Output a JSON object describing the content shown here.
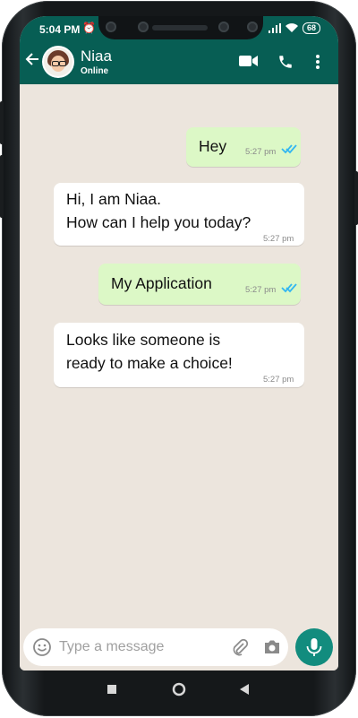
{
  "status_bar": {
    "time": "5:04 PM",
    "battery": "68"
  },
  "contact": {
    "name": "Niaa",
    "status": "Online"
  },
  "messages": [
    {
      "direction": "outgoing",
      "text": "Hey",
      "time": "5:27 pm",
      "read": true
    },
    {
      "direction": "incoming",
      "text": "Hi, I am Niaa.\nHow can I help you today?",
      "time": "5:27 pm"
    },
    {
      "direction": "outgoing",
      "text": "My Application",
      "time": "5:27 pm",
      "read": true
    },
    {
      "direction": "incoming",
      "text": "Looks like someone is\nready to make a choice!",
      "time": "5:27 pm"
    }
  ],
  "input": {
    "placeholder": "Type a message"
  },
  "icons": {
    "back": "arrow-left-icon",
    "video": "video-call-icon",
    "call": "phone-icon",
    "menu": "more-vert-icon",
    "emoji": "emoji-icon",
    "attach": "paperclip-icon",
    "camera": "camera-icon",
    "mic": "mic-icon",
    "read": "double-check-icon"
  },
  "colors": {
    "header": "#075e54",
    "outgoing_bubble": "#dcf8c6",
    "incoming_bubble": "#ffffff",
    "chat_bg": "#ece5dd",
    "read_ticks": "#34b7f1",
    "mic_button": "#128c7e"
  }
}
